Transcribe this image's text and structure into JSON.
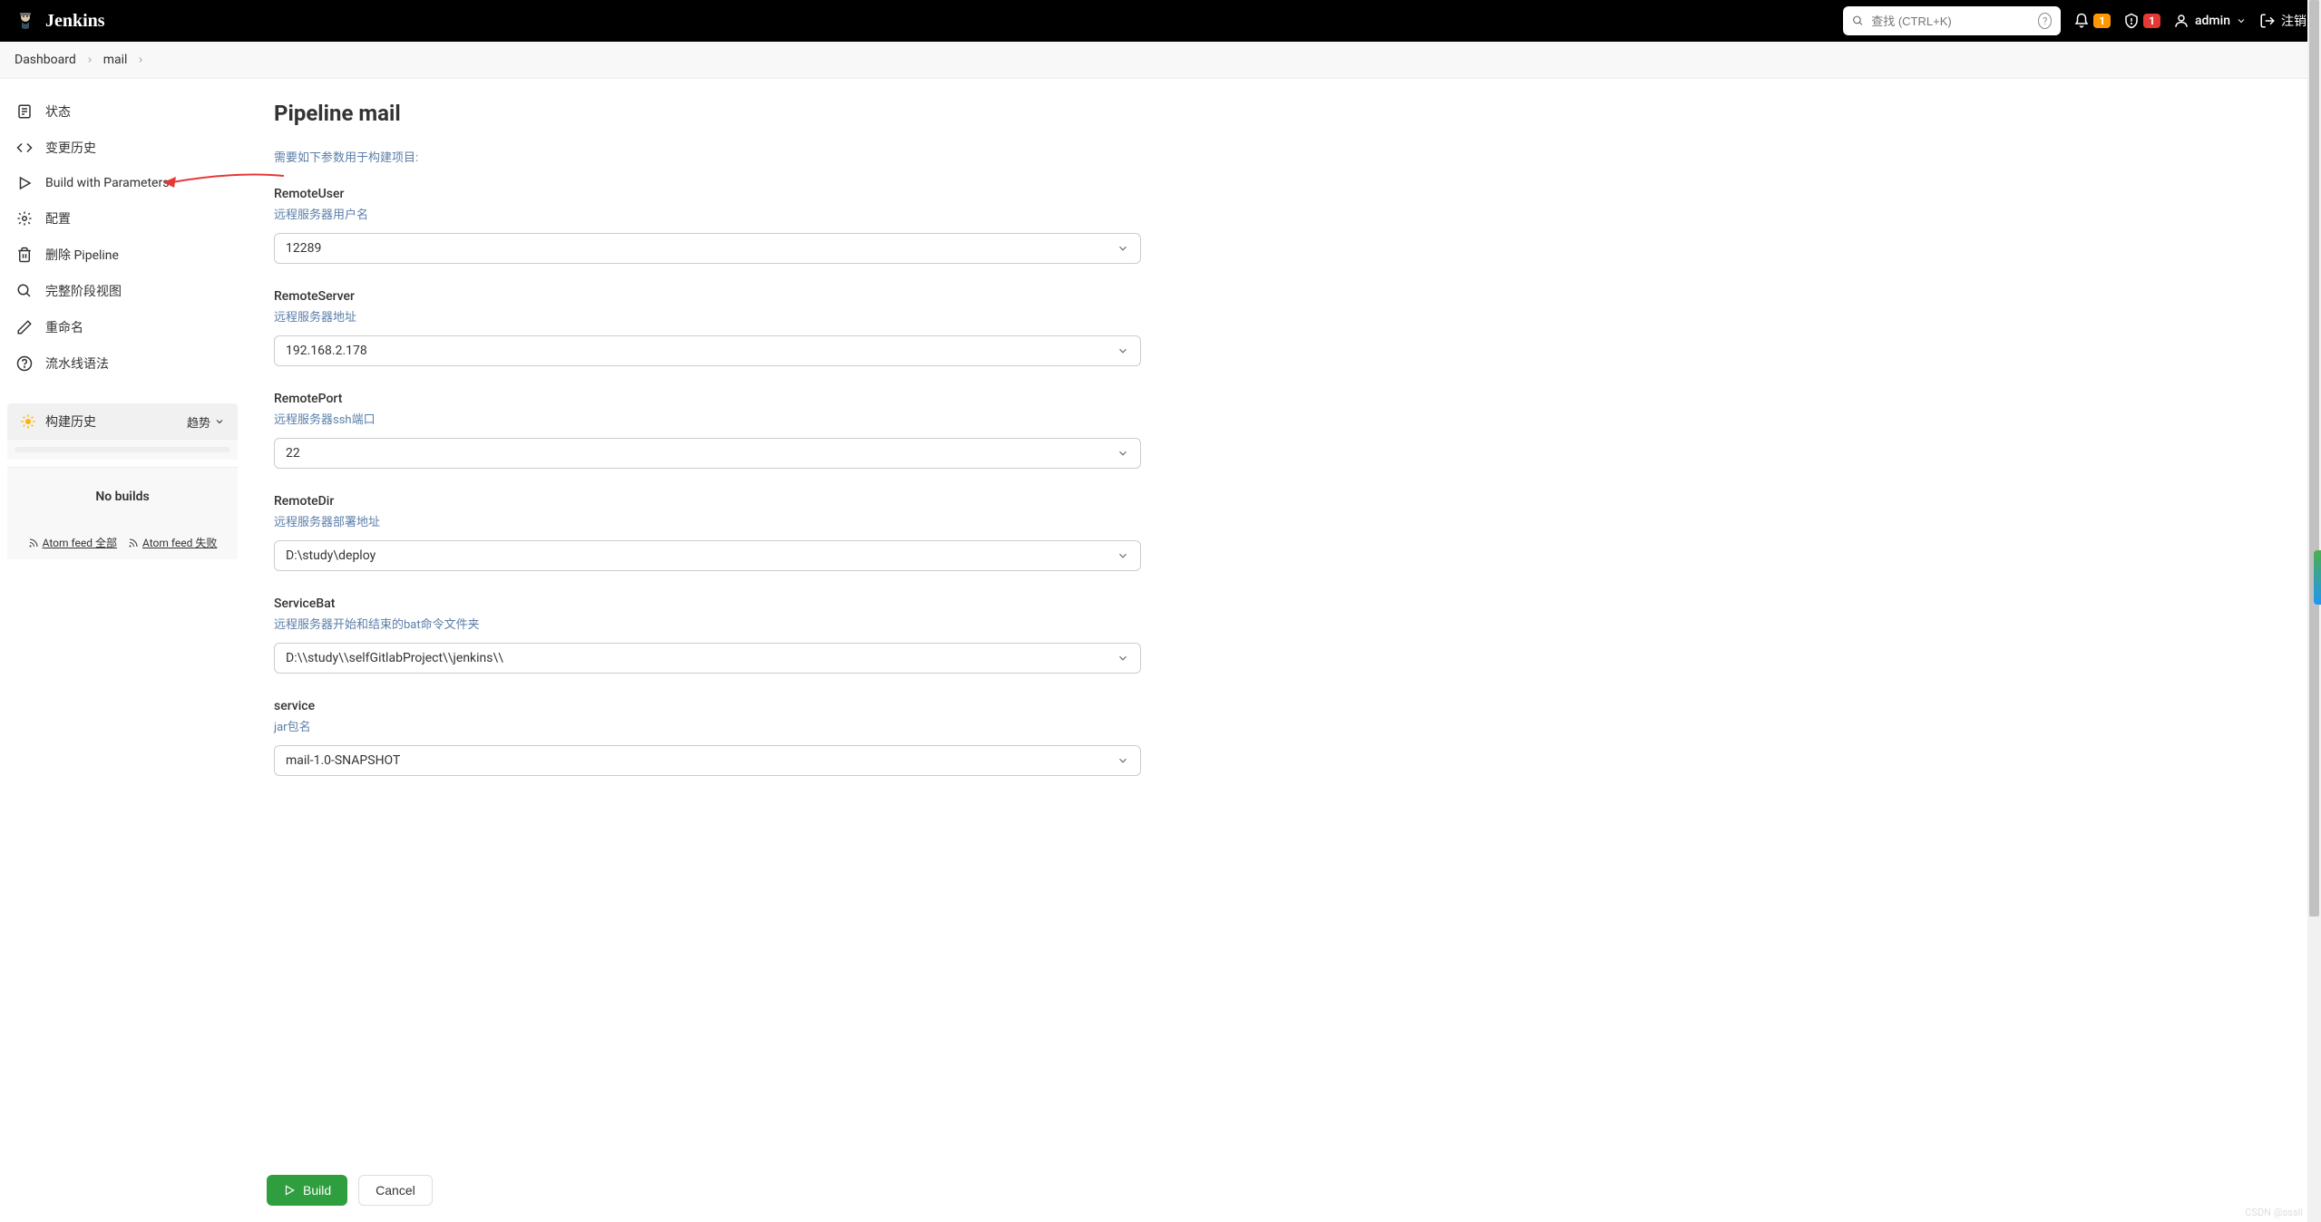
{
  "header": {
    "appName": "Jenkins",
    "search": {
      "placeholder": "查找 (CTRL+K)"
    },
    "notif_count": "1",
    "alert_count": "1",
    "user": "admin",
    "logout": "注销"
  },
  "breadcrumbs": [
    {
      "label": "Dashboard"
    },
    {
      "label": "mail"
    }
  ],
  "sidebar": {
    "items": [
      {
        "icon": "status",
        "label": "状态"
      },
      {
        "icon": "history",
        "label": "变更历史"
      },
      {
        "icon": "play",
        "label": "Build with Parameters"
      },
      {
        "icon": "gear",
        "label": "配置"
      },
      {
        "icon": "trash",
        "label": "删除 Pipeline"
      },
      {
        "icon": "search",
        "label": "完整阶段视图"
      },
      {
        "icon": "pencil",
        "label": "重命名"
      },
      {
        "icon": "help",
        "label": "流水线语法"
      }
    ],
    "buildHistory": {
      "title": "构建历史",
      "trend": "趋势",
      "empty": "No builds",
      "feedAll": "Atom feed 全部",
      "feedFail": "Atom feed 失败"
    }
  },
  "main": {
    "title": "Pipeline mail",
    "intro": "需要如下参数用于构建项目:",
    "params": [
      {
        "name": "RemoteUser",
        "desc": "远程服务器用户名",
        "value": "12289"
      },
      {
        "name": "RemoteServer",
        "desc": "远程服务器地址",
        "value": "192.168.2.178"
      },
      {
        "name": "RemotePort",
        "desc": "远程服务器ssh端口",
        "value": "22"
      },
      {
        "name": "RemoteDir",
        "desc": "远程服务器部署地址",
        "value": "D:\\study\\deploy"
      },
      {
        "name": "ServiceBat",
        "desc": "远程服务器开始和结束的bat命令文件夹",
        "value": "D:\\\\study\\\\selfGitlabProject\\\\jenkins\\\\"
      },
      {
        "name": "service",
        "desc": "jar包名",
        "value": "mail-1.0-SNAPSHOT"
      }
    ],
    "buildBtn": "Build",
    "cancelBtn": "Cancel"
  },
  "watermark": "CSDN @sssll"
}
